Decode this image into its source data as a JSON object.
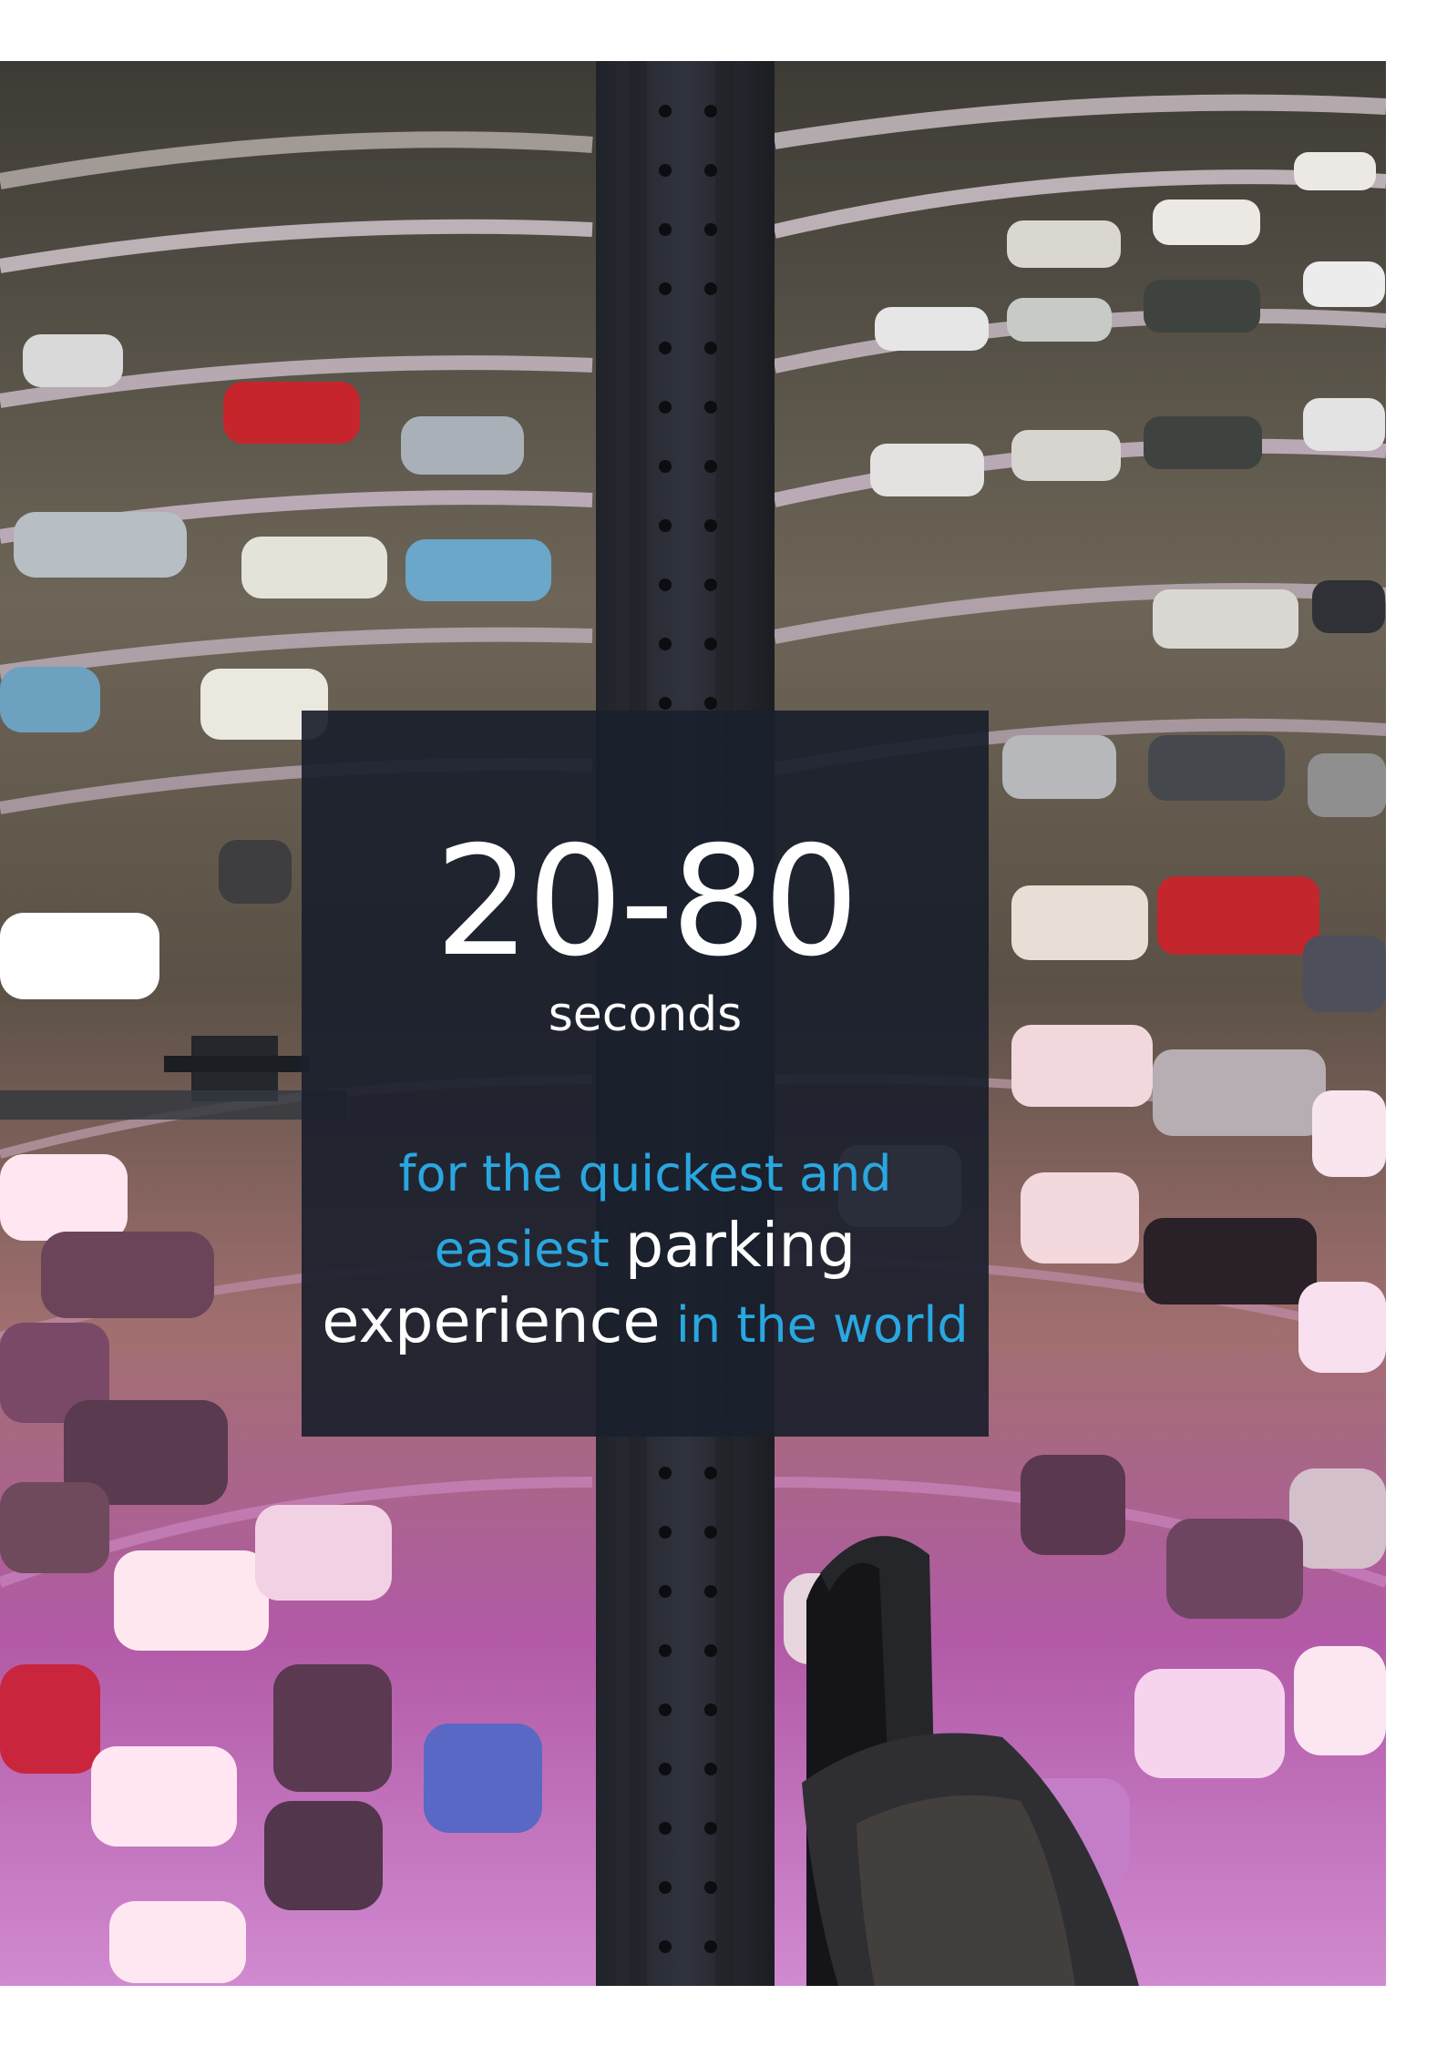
{
  "hero": {
    "number": "20-80",
    "unit": "seconds",
    "tagline": {
      "line1": "for the quickest and",
      "line2_accent": "easiest",
      "line2_white": "parking",
      "line3_white": "experience",
      "line3_accent": "in the world"
    }
  },
  "colors": {
    "accent": "#29a7e0",
    "box": "#1a202d"
  }
}
